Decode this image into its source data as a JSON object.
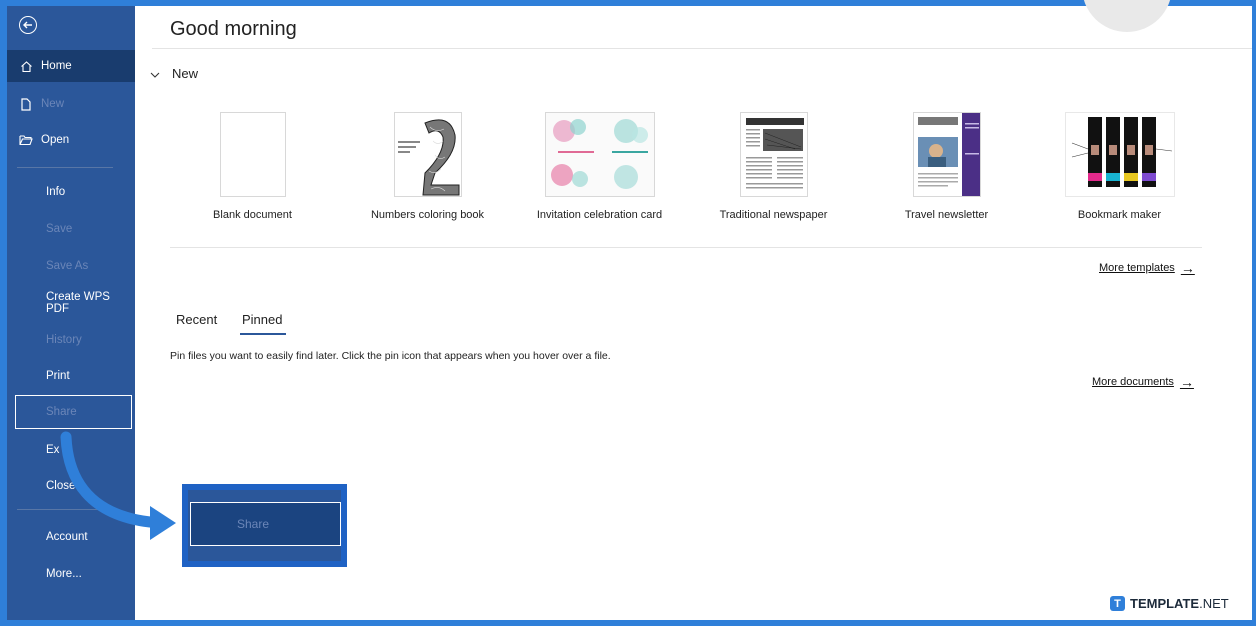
{
  "sidebar": {
    "back_icon": "back-arrow-icon",
    "items": {
      "home": "Home",
      "new": "New",
      "open": "Open",
      "info": "Info",
      "save": "Save",
      "save_as": "Save As",
      "create_wps_pdf": "Create WPS PDF",
      "history": "History",
      "print": "Print",
      "share": "Share",
      "export": "Ex",
      "close": "Close",
      "account": "Account",
      "more": "More..."
    }
  },
  "main": {
    "greeting": "Good morning",
    "new_section": "New",
    "templates": [
      {
        "label": "Blank document"
      },
      {
        "label": "Numbers coloring book"
      },
      {
        "label": "Invitation celebration card"
      },
      {
        "label": "Traditional newspaper"
      },
      {
        "label": "Travel newsletter"
      },
      {
        "label": "Bookmark maker"
      }
    ],
    "more_templates": "More templates",
    "tabs": {
      "recent": "Recent",
      "pinned": "Pinned"
    },
    "pin_hint": "Pin files you want to easily find later. Click the pin icon that appears when you hover over a file.",
    "more_documents": "More documents"
  },
  "callout": {
    "share_label": "Share"
  },
  "brand": {
    "name": "TEMPLATE",
    "suffix": ".NET",
    "logo_letter": "T"
  },
  "colors": {
    "sidebar": "#2b579a",
    "frame": "#2f7fd9",
    "active": "#193c6e"
  }
}
